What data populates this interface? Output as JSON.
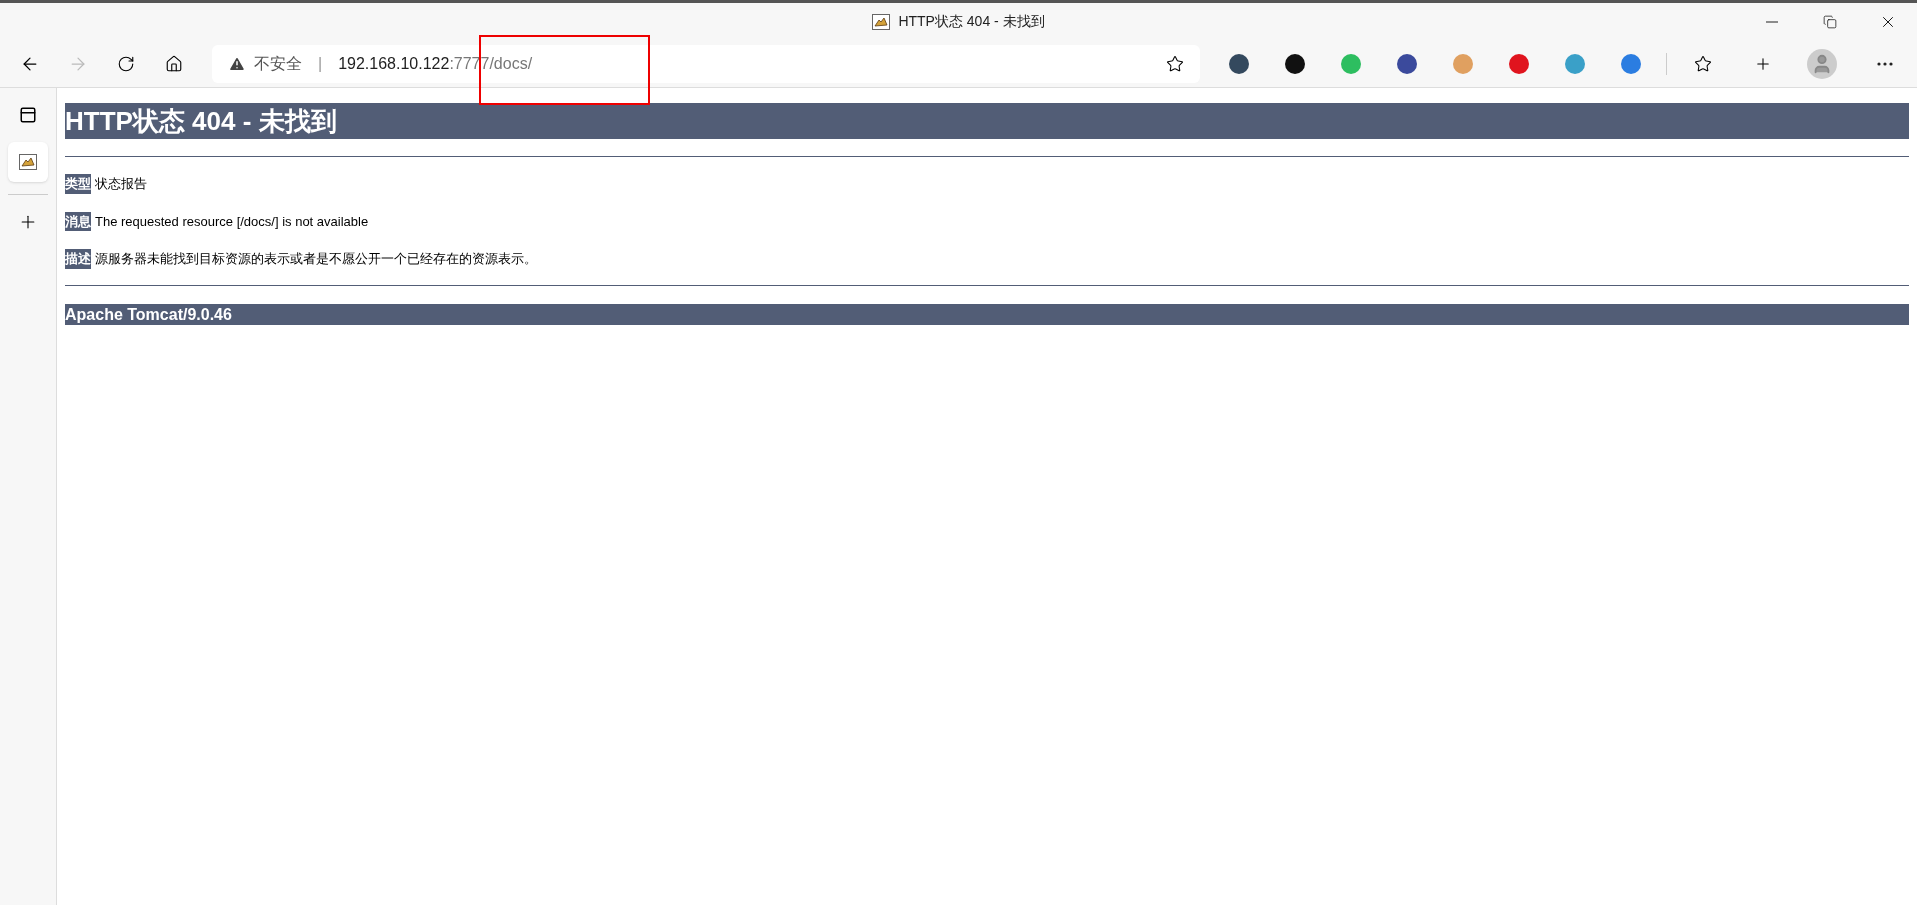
{
  "window": {
    "title": "HTTP状态 404 - 未找到"
  },
  "address_bar": {
    "security": "不安全",
    "separator": "|",
    "host": "192.168.10.122",
    "path": ":7777/docs/"
  },
  "page": {
    "heading": "HTTP状态 404 - 未找到",
    "fields": [
      {
        "label": "类型",
        "value": "状态报告"
      },
      {
        "label": "消息",
        "value": "The requested resource [/docs/] is not available"
      },
      {
        "label": "描述",
        "value": "源服务器未能找到目标资源的表示或者是不愿公开一个已经存在的资源表示。"
      }
    ],
    "footer": "Apache Tomcat/9.0.46"
  }
}
